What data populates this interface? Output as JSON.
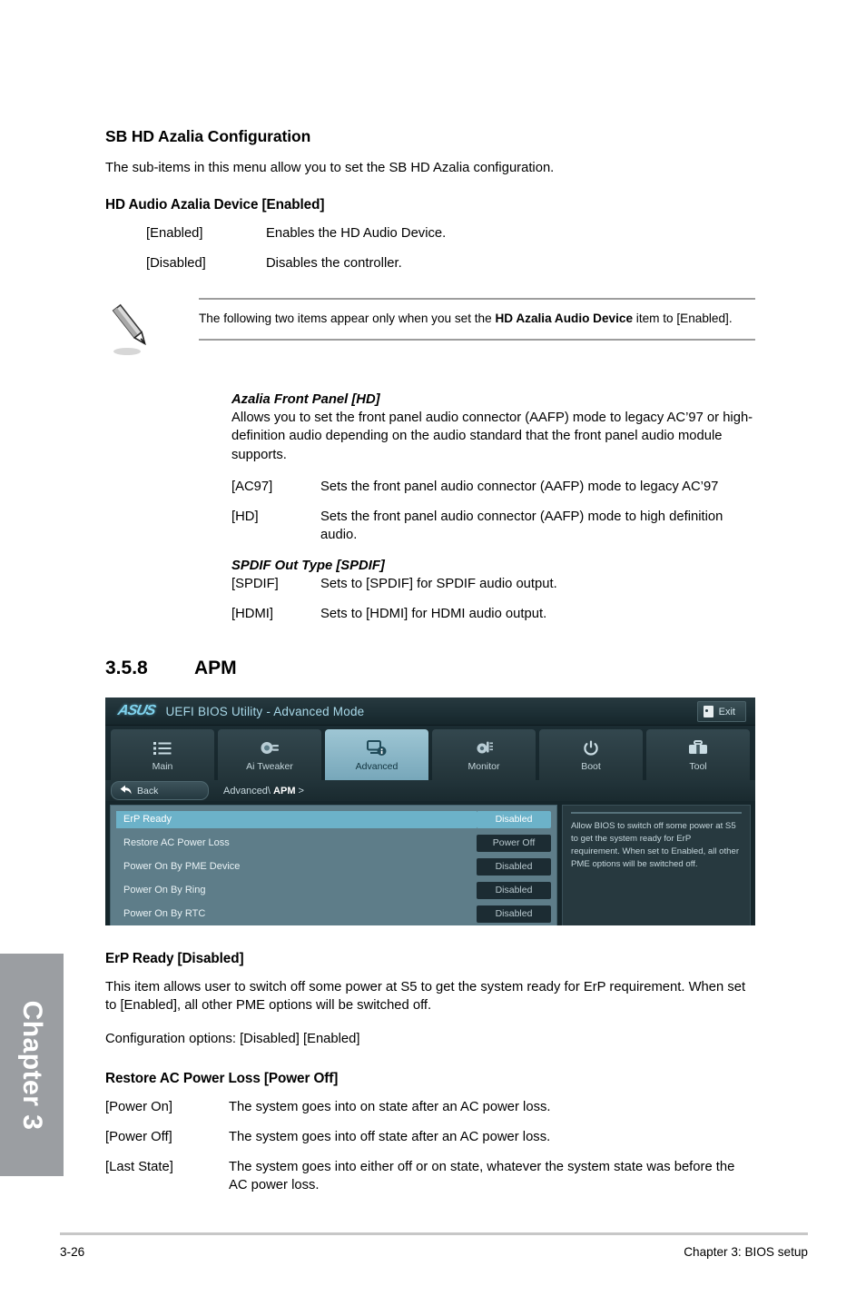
{
  "document": {
    "chapter_tab_label": "Chapter 3",
    "footer": {
      "page_number": "3-26",
      "chapter_text": "Chapter 3: BIOS setup"
    }
  },
  "sb_hd_azalia": {
    "title": "SB HD Azalia Configuration",
    "intro": "The sub-items in this menu allow you to set the SB HD Azalia configuration.",
    "hd_audio": {
      "title": "HD Audio Azalia Device [Enabled]",
      "options": [
        {
          "term": "[Enabled]",
          "desc": "Enables the HD Audio Device."
        },
        {
          "term": "[Disabled]",
          "desc": "Disables the controller."
        }
      ]
    },
    "note": {
      "icon": "pencil-note-icon",
      "text_before": "The following two items appear only when you set the ",
      "text_bold": "HD Azalia Audio Device",
      "text_after": " item to [Enabled]."
    },
    "azalia_front_panel": {
      "title": "Azalia Front Panel [HD]",
      "description": "Allows you to set the front panel audio connector (AAFP) mode to legacy AC’97 or high-definition audio depending on the audio standard that the front panel audio module supports.",
      "options": [
        {
          "term": "[AC97]",
          "desc": "Sets the front panel audio connector (AAFP) mode to legacy AC’97"
        },
        {
          "term": "[HD]",
          "desc": "Sets the front panel audio connector (AAFP) mode to high definition audio."
        }
      ]
    },
    "spdif_out_type": {
      "title": "SPDIF Out Type [SPDIF]",
      "options": [
        {
          "term": "[SPDIF]",
          "desc": "Sets to [SPDIF] for SPDIF audio output."
        },
        {
          "term": "[HDMI]",
          "desc": "Sets to [HDMI] for HDMI audio output."
        }
      ]
    }
  },
  "apm_section": {
    "number": "3.5.8",
    "name": "APM"
  },
  "bios": {
    "header": {
      "logo": "ASUS",
      "title": "UEFI BIOS Utility - Advanced Mode",
      "exit_label": "Exit",
      "exit_icon": "exit-door-icon"
    },
    "tabs": [
      {
        "label": "Main",
        "icon": "list-icon",
        "active": false
      },
      {
        "label": "Ai  Tweaker",
        "icon": "tweaker-knob-icon",
        "active": false
      },
      {
        "label": "Advanced",
        "icon": "monitor-info-icon",
        "active": true
      },
      {
        "label": "Monitor",
        "icon": "thermometer-icon",
        "active": false
      },
      {
        "label": "Boot",
        "icon": "power-icon",
        "active": false
      },
      {
        "label": "Tool",
        "icon": "toolbox-icon",
        "active": false
      }
    ],
    "breadcrumb": {
      "back_label": "Back",
      "back_icon": "back-arrow-icon",
      "path_prefix": "Advanced\\ ",
      "path_current": "APM",
      "path_suffix": " >"
    },
    "items": [
      {
        "name": "ErP Ready",
        "value": "Disabled",
        "selected": true
      },
      {
        "name": "Restore AC Power Loss",
        "value": "Power Off",
        "selected": false
      },
      {
        "name": "Power On By PME Device",
        "value": "Disabled",
        "selected": false
      },
      {
        "name": "Power On By Ring",
        "value": "Disabled",
        "selected": false
      },
      {
        "name": "Power On By RTC",
        "value": "Disabled",
        "selected": false
      }
    ],
    "help_text": "Allow BIOS to switch off some power at S5 to get the system ready for ErP requirement. When set to Enabled, all other PME options will be switched off.",
    "colors": {
      "accent": "#6cb2c9",
      "panel": "#5e7d89",
      "background": "#16262b",
      "logo": "#7fd3ee"
    }
  },
  "erp_ready": {
    "title": "ErP Ready [Disabled]",
    "description": "This item allows user to switch off some power at S5 to get the system ready for ErP requirement. When set to [Enabled], all other PME options will be switched off.",
    "config_options": "Configuration options: [Disabled] [Enabled]"
  },
  "restore_ac_power_loss": {
    "title": "Restore AC Power Loss [Power Off]",
    "options": [
      {
        "term": "[Power On]",
        "desc": "The system goes into on state after an AC power loss."
      },
      {
        "term": "[Power Off]",
        "desc": "The system goes into off state after an AC power loss."
      },
      {
        "term": "[Last State]",
        "desc": "The system goes into either off or on state, whatever the system state was before the AC power loss."
      }
    ]
  }
}
